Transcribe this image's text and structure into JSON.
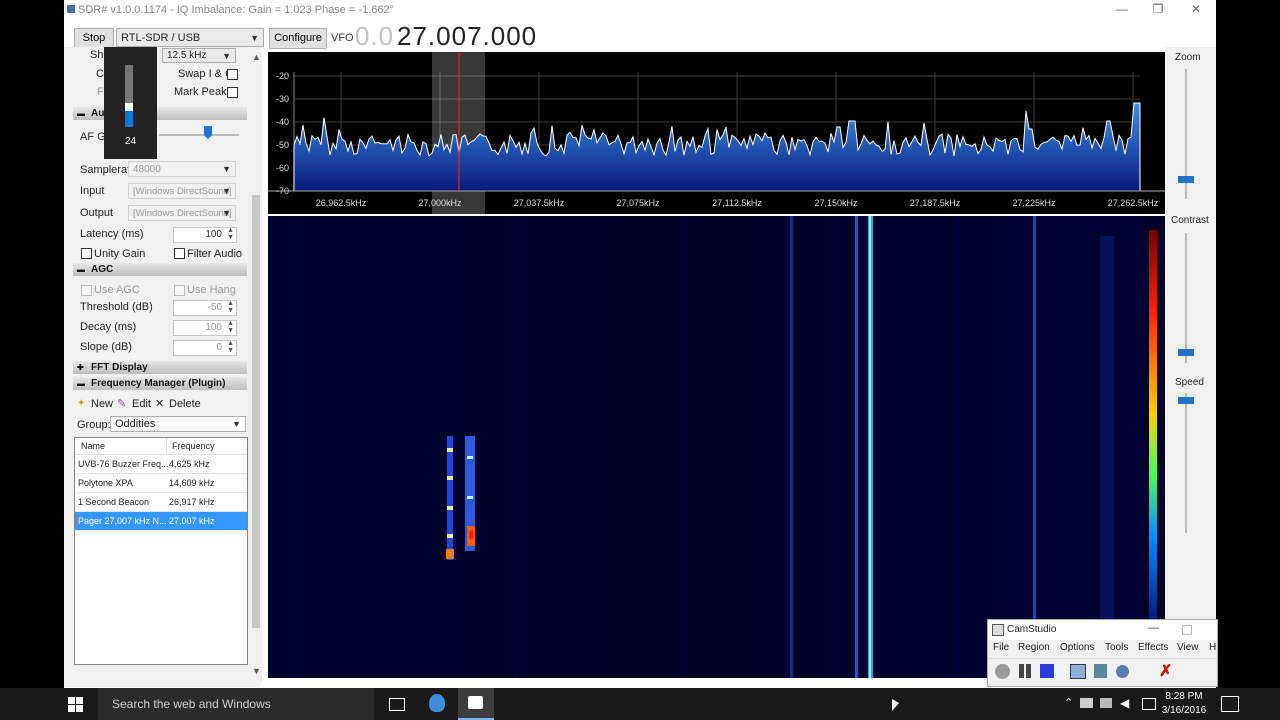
{
  "window": {
    "title": "SDR# v1.0.0.1174 - IQ Imbalance: Gain = 1.023 Phase = -1.662°",
    "minimize": "—",
    "restore": "❐",
    "close": "✕"
  },
  "toolbar": {
    "stop_label": "Stop",
    "source": "RTL-SDR / USB",
    "configure_label": "Configure",
    "vfo_label": "VFO",
    "vfo_dim": "0.0",
    "vfo_value": "27.007.000"
  },
  "radio": {
    "shift_label": "Sh",
    "bandwidth": "12.5 kHz",
    "swap_iq_label": "Swap I & Q",
    "mark_peaks_label": "Mark Peaks",
    "c_label": "C",
    "f_label": "F"
  },
  "volume_popup": {
    "value": "24"
  },
  "audio": {
    "header": "Au",
    "af_gain_label": "AF Ga",
    "samplerate_label": "Samplerate",
    "samplerate_value": "48000",
    "input_label": "Input",
    "input_value": "[Windows DirectSound]",
    "output_label": "Output",
    "output_value": "[Windows DirectSound]",
    "latency_label": "Latency (ms)",
    "latency_value": "100",
    "unity_gain_label": "Unity Gain",
    "filter_audio_label": "Filter Audio"
  },
  "agc": {
    "header": "AGC",
    "use_agc_label": "Use AGC",
    "use_hang_label": "Use Hang",
    "threshold_label": "Threshold (dB)",
    "threshold_value": "-50",
    "decay_label": "Decay (ms)",
    "decay_value": "100",
    "slope_label": "Slope (dB)",
    "slope_value": "0"
  },
  "fft_display": {
    "header": "FFT Display"
  },
  "freq_manager": {
    "header": "Frequency Manager (Plugin)",
    "new_label": "New",
    "edit_label": "Edit",
    "delete_label": "Delete",
    "group_label": "Group:",
    "group_value": "Oddities",
    "columns": [
      "Name",
      "Frequency"
    ],
    "rows": [
      {
        "name": "UVB-76 Buzzer Freq...",
        "freq": "4,625 kHz"
      },
      {
        "name": "Polytone XPA",
        "freq": "14,609 kHz"
      },
      {
        "name": "1 Second Beacon",
        "freq": "26,917 kHz"
      },
      {
        "name": "Pager 27,007 kHz N...",
        "freq": "27,007 kHz"
      }
    ]
  },
  "spectrum": {
    "db_labels": [
      "-20",
      "-30",
      "-40",
      "-50",
      "-60",
      "-70"
    ],
    "freq_labels": [
      "26,962.5kHz",
      "27,000kHz",
      "27,037.5kHz",
      "27,075kHz",
      "27,112.5kHz",
      "27,150kHz",
      "27,187.5kHz",
      "27,225kHz",
      "27,262.5kHz"
    ]
  },
  "right_panel": {
    "zoom_label": "Zoom",
    "contrast_label": "Contrast",
    "speed_label": "Speed"
  },
  "camstudio": {
    "title": "CamStudio",
    "menu": [
      "File",
      "Region",
      "Options",
      "Tools",
      "Effects",
      "View",
      "H"
    ]
  },
  "taskbar": {
    "search_placeholder": "Search the web and Windows",
    "time": "8:28 PM",
    "date": "3/16/2016"
  }
}
